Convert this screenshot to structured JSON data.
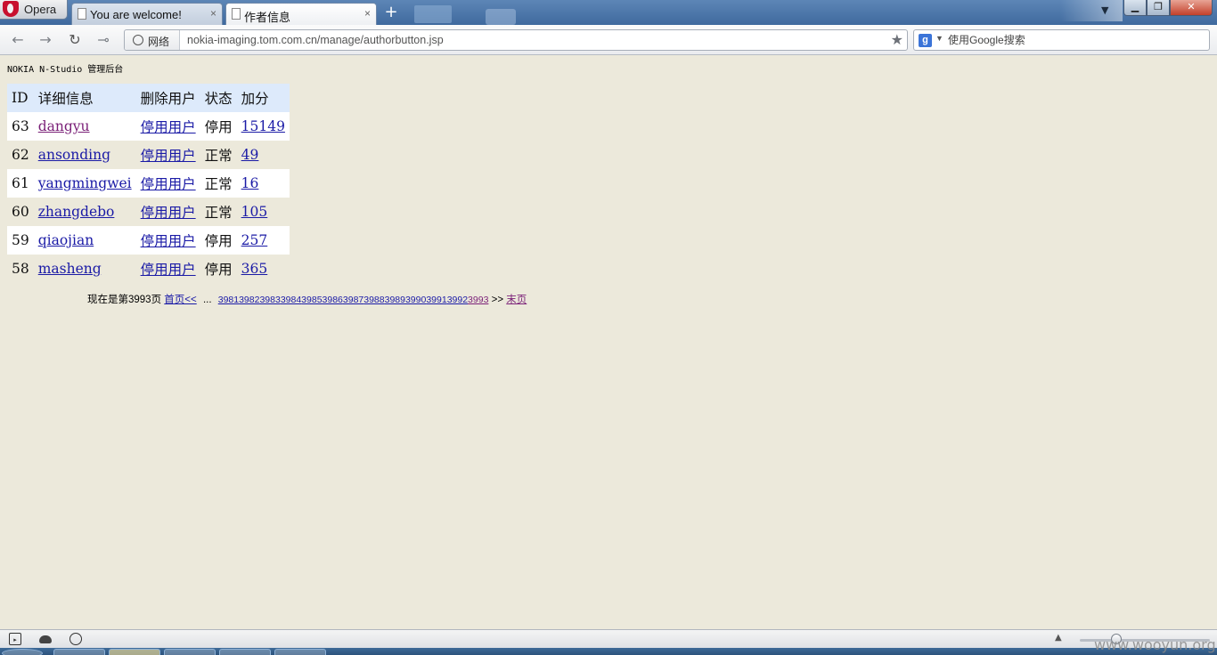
{
  "browser": {
    "menu_label": "Opera",
    "tabs": [
      {
        "title": "You are welcome!",
        "active": false
      },
      {
        "title": "作者信息",
        "active": true
      }
    ],
    "new_tab_glyph": "+",
    "close_glyph": "×",
    "address": {
      "security_label": "网络",
      "url": "nokia-imaging.tom.com.cn/manage/authorbutton.jsp"
    },
    "search": {
      "engine_label": "g",
      "placeholder": "使用Google搜索"
    }
  },
  "page": {
    "site_title": "NOKIA  N-Studio 管理后台",
    "table": {
      "headers": [
        "ID",
        "详细信息",
        "删除用户",
        "状态",
        "加分"
      ],
      "rows": [
        {
          "id": "63",
          "name": "dangyu",
          "action": "停用用户",
          "status": "停用",
          "score": "15149",
          "name_visited": true
        },
        {
          "id": "62",
          "name": "ansonding",
          "action": "停用用户",
          "status": "正常",
          "score": "49",
          "name_visited": false
        },
        {
          "id": "61",
          "name": "yangmingwei",
          "action": "停用用户",
          "status": "正常",
          "score": "16",
          "name_visited": false
        },
        {
          "id": "60",
          "name": "zhangdebo",
          "action": "停用用户",
          "status": "正常",
          "score": "105",
          "name_visited": false
        },
        {
          "id": "59",
          "name": "qiaojian",
          "action": "停用用户",
          "status": "停用",
          "score": "257",
          "name_visited": false
        },
        {
          "id": "58",
          "name": "masheng",
          "action": "停用用户",
          "status": "停用",
          "score": "365",
          "name_visited": false
        }
      ]
    },
    "pager": {
      "current_text": "现在是第3993页",
      "first_label": "首页<<",
      "ellipsis": "...",
      "pages": [
        "3981",
        "3982",
        "3983",
        "3984",
        "3985",
        "3986",
        "3987",
        "3988",
        "3989",
        "3990",
        "3991",
        "3992"
      ],
      "current_page": "3993",
      "next_glyph": ">>",
      "last_label": "末页"
    }
  },
  "watermark": "www.wooyun.org",
  "colors": {
    "page_background": "#ece9db",
    "header_background": "#ddeafb",
    "link": "#1a1aa6",
    "visited_link": "#7a1f77"
  }
}
